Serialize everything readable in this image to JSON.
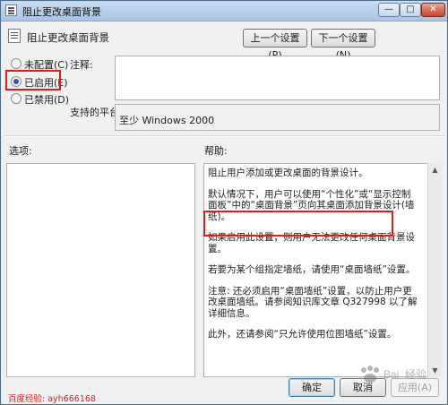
{
  "window": {
    "title": "阻止更改桌面背景",
    "controls": {
      "minimize": "—",
      "maximize": "□",
      "close": "✕"
    }
  },
  "header": {
    "setting_title": "阻止更改桌面背景",
    "prev_button": "上一个设置(P)",
    "next_button": "下一个设置(N)"
  },
  "state": {
    "options": [
      {
        "label": "未配置(C)",
        "checked": false
      },
      {
        "label": "已启用(E)",
        "checked": true
      },
      {
        "label": "已禁用(D)",
        "checked": false
      }
    ]
  },
  "comment": {
    "label": "注释:",
    "value": ""
  },
  "platform": {
    "label": "支持的平台:",
    "value": "至少 Windows 2000"
  },
  "options_section": {
    "label": "选项:"
  },
  "help": {
    "label": "帮助:",
    "paragraphs": [
      "阻止用户添加或更改桌面的背景设计。",
      "默认情况下，用户可以使用“个性化”或“显示控制面板”中的“桌面背景”页向其桌面添加背景设计(墙纸)。",
      "如果启用此设置，则用户无法更改任何桌面背景设置。",
      "若要为某个组指定墙纸，请使用“桌面墙纸”设置。",
      "注意: 还必须启用“桌面墙纸”设置，以防止用户更改桌面墙纸。请参阅知识库文章 Q327998 以了解详细信息。",
      "此外，还请参阅“只允许使用位图墙纸”设置。"
    ]
  },
  "footer": {
    "ok_button": "确定",
    "cancel_button": "取消",
    "apply_button": "应用(A)",
    "watermark": "百度经验: ayh666168",
    "logo_text": "Bai 经验"
  },
  "colors": {
    "highlight": "#e21b1b",
    "watermark": "#dd2222"
  }
}
